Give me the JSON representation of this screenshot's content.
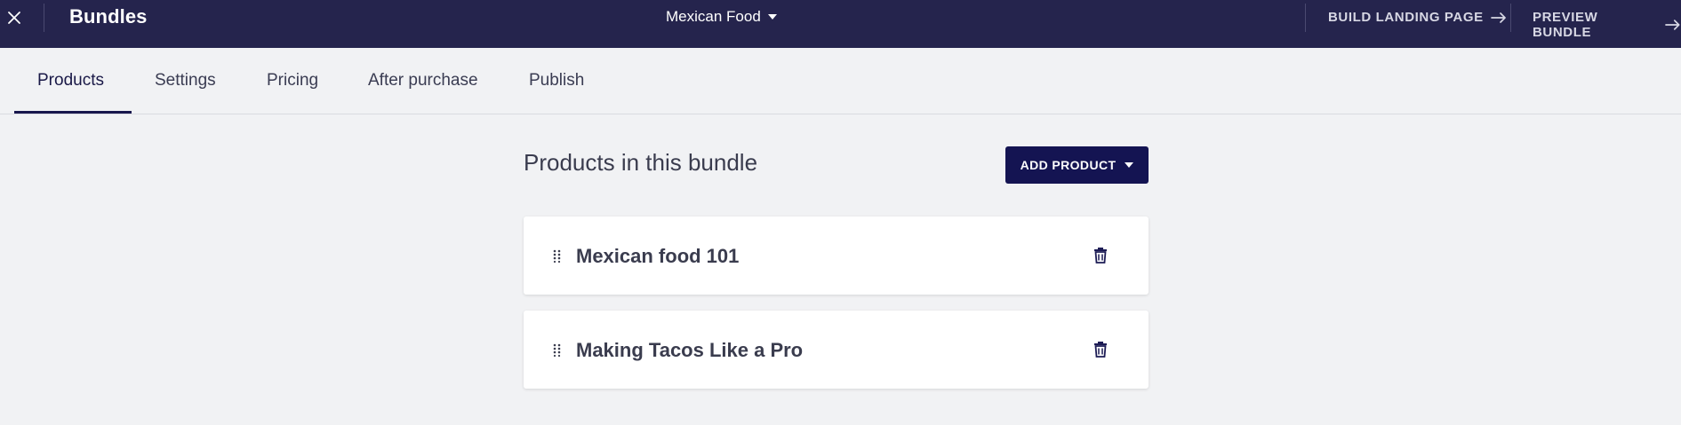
{
  "header": {
    "close_icon": "close-icon",
    "title": "Bundles",
    "bundle_name": "Mexican Food",
    "actions": [
      {
        "label": "BUILD LANDING PAGE",
        "icon": "arrow-right-icon"
      },
      {
        "label": "PREVIEW BUNDLE",
        "icon": "arrow-right-icon"
      }
    ]
  },
  "tabs": [
    {
      "label": "Products",
      "active": true
    },
    {
      "label": "Settings",
      "active": false
    },
    {
      "label": "Pricing",
      "active": false
    },
    {
      "label": "After purchase",
      "active": false
    },
    {
      "label": "Publish",
      "active": false
    }
  ],
  "main": {
    "title": "Products in this bundle",
    "add_button_label": "ADD PRODUCT",
    "products": [
      {
        "name": "Mexican food 101"
      },
      {
        "name": "Making Tacos Like a Pro"
      }
    ]
  },
  "colors": {
    "header_bg": "#25244d",
    "primary_button": "#141452",
    "page_bg": "#f1f2f4"
  }
}
